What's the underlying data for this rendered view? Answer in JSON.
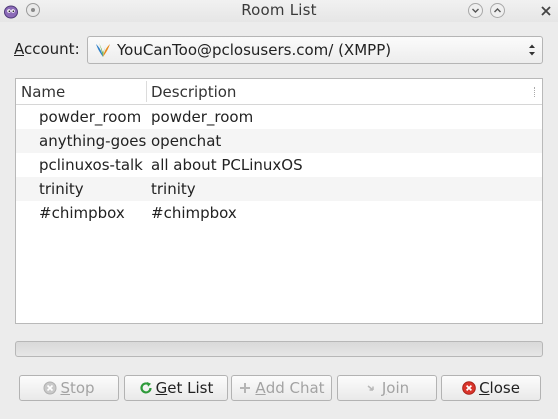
{
  "window": {
    "title": "Room List",
    "app_icon": "pidgin-icon",
    "controls": [
      "menu-icon",
      "minimize-icon",
      "maximize-icon",
      "close-icon"
    ]
  },
  "account": {
    "label_mnemonic": "A",
    "label_rest": "ccount:",
    "selected": "YouCanToo@pclosusers.com/ (XMPP)",
    "icon": "xmpp-icon"
  },
  "room_list": {
    "columns": [
      "Name",
      "Description"
    ],
    "rows": [
      {
        "name": "powder_room",
        "description": "powder_room"
      },
      {
        "name": "anything-goes",
        "description": "openchat"
      },
      {
        "name": "pclinuxos-talk",
        "description": "all about PCLinuxOS"
      },
      {
        "name": "trinity",
        "description": "trinity"
      },
      {
        "name": "#chimpbox",
        "description": "#chimpbox"
      }
    ]
  },
  "progress": {
    "fraction": 0
  },
  "buttons": {
    "stop": {
      "mnemonic": "S",
      "rest": "top",
      "icon": "stop-icon",
      "enabled": false
    },
    "get_list": {
      "mnemonic": "G",
      "rest": "et List",
      "icon": "refresh-icon",
      "enabled": true
    },
    "add_chat": {
      "mnemonic": "A",
      "rest": "dd Chat",
      "icon": "add-icon",
      "enabled": false
    },
    "join": {
      "mnemonic": "J",
      "rest": "oin",
      "icon": "join-icon",
      "enabled": false
    },
    "close": {
      "mnemonic": "C",
      "rest": "lose",
      "icon": "close-circle-icon",
      "enabled": true
    }
  },
  "colors": {
    "window_bg": "#ececec",
    "list_alt_row": "#f5f5f5",
    "close_red": "#d9342b",
    "refresh_green": "#2e9a3a",
    "disabled_text": "#a3a3a3"
  }
}
